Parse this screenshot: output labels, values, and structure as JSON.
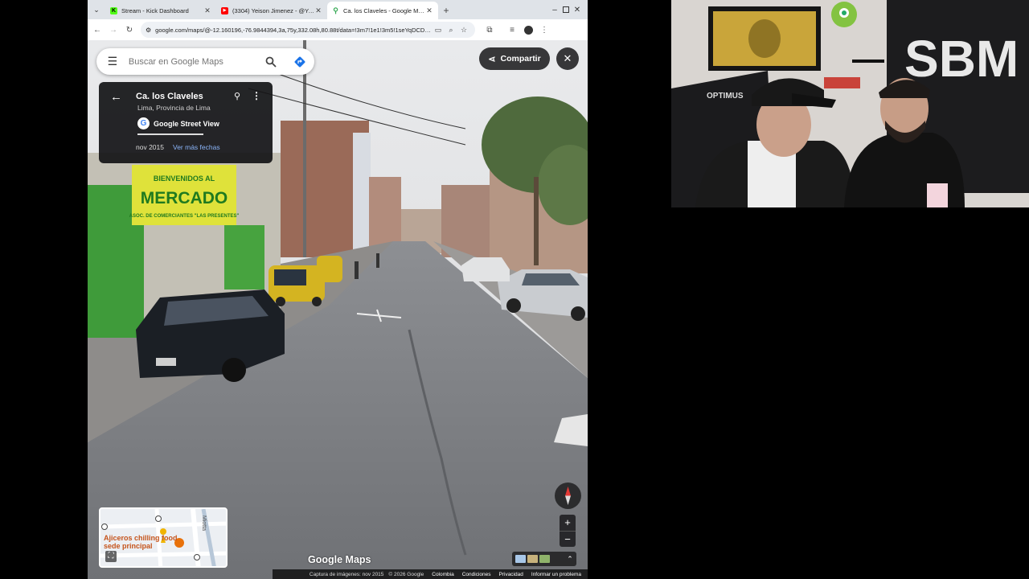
{
  "browser": {
    "tabs": [
      {
        "title": "Stream - Kick Dashboard",
        "favicon_letter": "K",
        "favicon_color": "#53fc18",
        "active": false
      },
      {
        "title": "(3304) Yeison Jimenez - @Yeiso",
        "favicon_letter": "▶",
        "favicon_color": "#ff0000",
        "active": false
      },
      {
        "title": "Ca. los Claveles - Google Maps",
        "favicon_letter": "⚲",
        "favicon_color": "#34a853",
        "active": true
      }
    ],
    "new_tab": "+",
    "url": "google.com/maps/@-12.160196,-76.9844394,3a,75y,332.08h,80.88t/data=!3m7!1e1!3m5!1seYqDCDiF..."
  },
  "maps": {
    "search_placeholder": "Buscar en Google Maps",
    "share_label": "Compartir",
    "info": {
      "street": "Ca. los Claveles",
      "region": "Lima, Provincia de Lima",
      "source": "Google Street View",
      "date": "nov 2015",
      "more_dates": "Ver más fechas"
    },
    "minimap": {
      "poi": "Ajiceros chilling food sede principal",
      "street": "Miotta"
    },
    "logo": "Google Maps",
    "footer": {
      "capture": "Captura de imágenes: nov 2015",
      "copyright": "© 2026 Google",
      "country": "Colombia",
      "terms": "Condiciones",
      "privacy": "Privacidad",
      "report": "Informar un problema"
    },
    "zoom_in": "+",
    "zoom_out": "−"
  },
  "scene_signs": {
    "market_line1": "BIENVENIDOS AL",
    "market_line2": "MERCADO",
    "market_line3": "ASOC. DE COMERCIANTES \"LAS PRESENTES\""
  },
  "webcam": {
    "wall_brand": "SBM",
    "chair_brand": "OPTIMUS"
  }
}
